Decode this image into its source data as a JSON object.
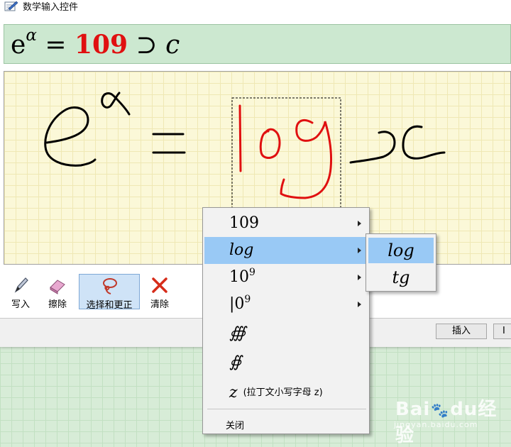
{
  "window": {
    "title": "数学输入控件"
  },
  "result": {
    "base": "e",
    "exponent": "α",
    "equals": "=",
    "number": "109",
    "superset": "⊃",
    "variable": "c"
  },
  "colors": {
    "accent_red": "#e01010",
    "result_bg": "#cce8d0",
    "ink_bg": "#fbf8d8",
    "menu_highlight": "#99c9f5"
  },
  "toolbar": {
    "write": {
      "label": "写入",
      "icon": "pen-icon"
    },
    "erase": {
      "label": "擦除",
      "icon": "eraser-icon"
    },
    "select_correct": {
      "label": "选择和更正",
      "icon": "lasso-icon",
      "active": true
    },
    "clear": {
      "label": "清除",
      "icon": "clear-x-icon"
    }
  },
  "buttons": {
    "insert": "插入",
    "second": "I"
  },
  "menu": {
    "items": [
      {
        "text": "109",
        "has_submenu": true
      },
      {
        "text": "log",
        "has_submenu": true,
        "highlighted": true
      },
      {
        "base": "10",
        "sup": "9",
        "has_submenu": true
      },
      {
        "base": "|0",
        "sup": "9",
        "has_submenu": true
      },
      {
        "text": "∰",
        "has_submenu": false
      },
      {
        "text": "∯",
        "has_submenu": false
      },
      {
        "text": "z",
        "note": "(拉丁文小写字母 z)",
        "has_submenu": false
      }
    ],
    "close": "关闭"
  },
  "submenu": {
    "items": [
      "log",
      "tg"
    ],
    "selected": "log"
  },
  "watermark": {
    "brand_1": "Bai",
    "brand_2": "du",
    "brand_3": "经验",
    "url": "jingyan.baidu.com"
  }
}
